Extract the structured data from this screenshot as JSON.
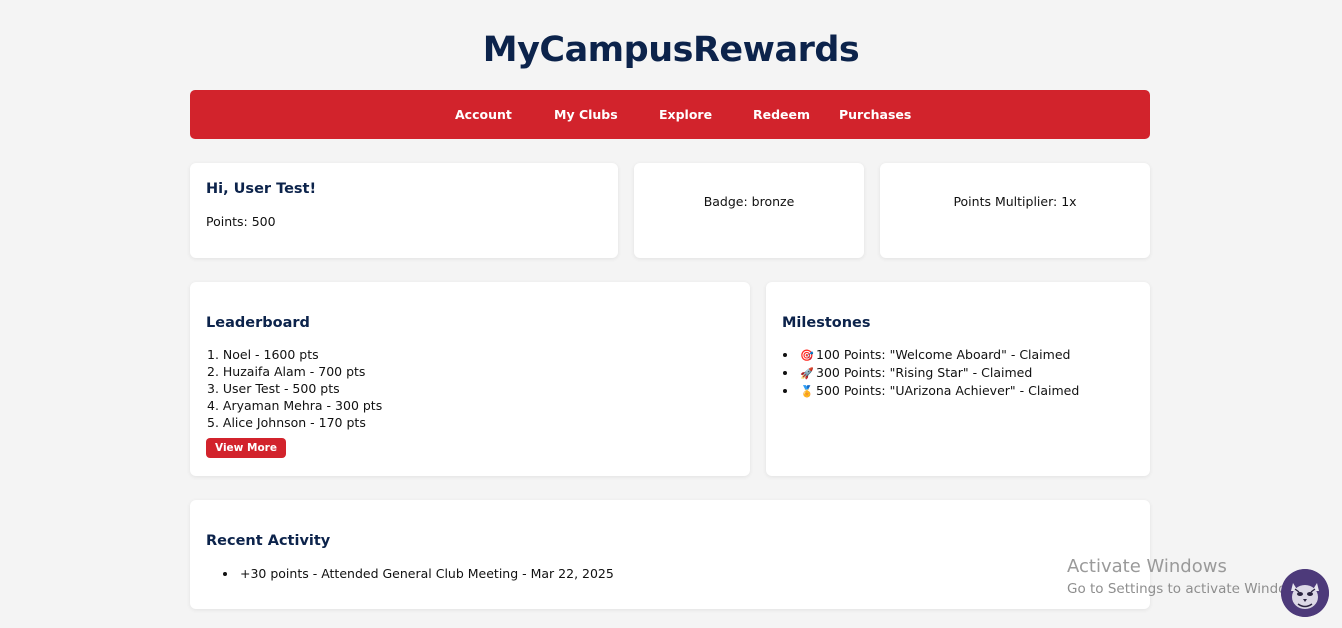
{
  "header": {
    "title": "MyCampusRewards"
  },
  "nav": {
    "items": [
      "Account",
      "My Clubs",
      "Explore",
      "Redeem",
      "Purchases"
    ]
  },
  "greeting": {
    "title": "Hi, User Test!",
    "points": "Points: 500"
  },
  "badge": {
    "text": "Badge: bronze"
  },
  "multiplier": {
    "text": "Points Multiplier: 1x"
  },
  "leaderboard": {
    "title": "Leaderboard",
    "entries": [
      "1. Noel - 1600 pts",
      "2. Huzaifa Alam - 700 pts",
      "3. User Test - 500 pts",
      "4. Aryaman Mehra - 300 pts",
      "5. Alice Johnson - 170 pts"
    ],
    "view_more": "View More"
  },
  "milestones": {
    "title": "Milestones",
    "items": [
      {
        "icon": "target-icon",
        "glyph": "🎯",
        "text": "100 Points: \"Welcome Aboard\" - Claimed"
      },
      {
        "icon": "rocket-icon",
        "glyph": "🚀",
        "text": "300 Points: \"Rising Star\" - Claimed"
      },
      {
        "icon": "medal-icon",
        "glyph": "🏅",
        "text": "500 Points: \"UArizona Achiever\" - Claimed"
      }
    ]
  },
  "activity": {
    "title": "Recent Activity",
    "items": [
      "+30 points - Attended General Club Meeting - Mar 22, 2025"
    ]
  },
  "watermark": {
    "line1": "Activate Windows",
    "line2": "Go to Settings to activate Windows."
  },
  "colors": {
    "primary_red": "#d2232c",
    "navy": "#0c234b",
    "background": "#f4f4f4"
  }
}
